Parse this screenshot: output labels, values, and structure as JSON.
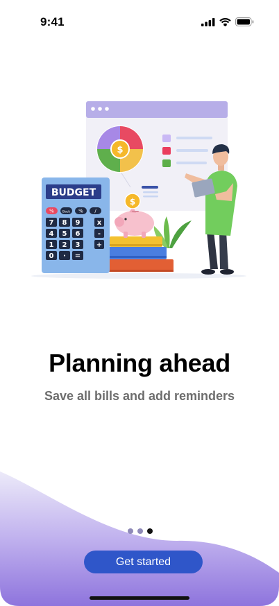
{
  "status_bar": {
    "time": "9:41",
    "icons": [
      "signal-icon",
      "wifi-icon",
      "battery-icon"
    ]
  },
  "illustration": {
    "calculator_label": "BUDGET",
    "keys": [
      "%",
      "Back",
      "%",
      "/",
      "7",
      "8",
      "9",
      "x",
      "4",
      "5",
      "6",
      "-",
      "1",
      "2",
      "3",
      "+",
      "0",
      "·",
      "="
    ]
  },
  "onboarding": {
    "title": "Planning ahead",
    "subtitle": "Save all bills and add reminders",
    "page_count": 3,
    "active_page": 3,
    "cta_label": "Get started"
  },
  "colors": {
    "accent": "#2f56c9",
    "wave_top": "#eceaf9",
    "wave_bottom": "#8e74dd"
  }
}
